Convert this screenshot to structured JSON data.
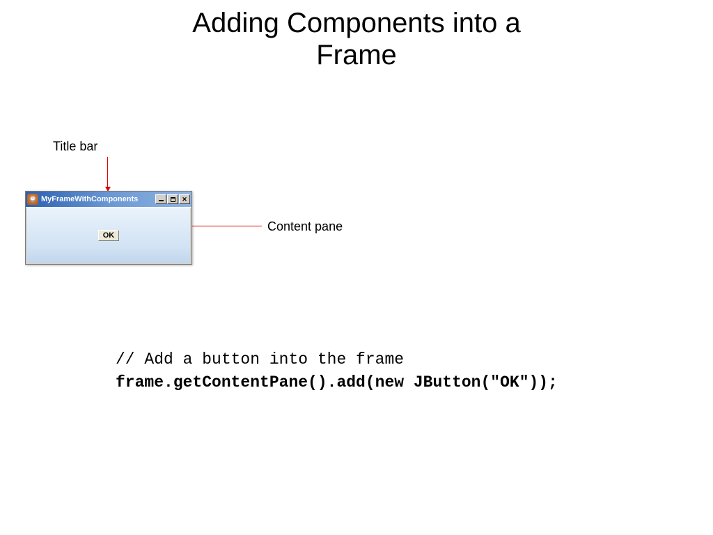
{
  "title_line1": "Adding Components into a",
  "title_line2": "Frame",
  "labels": {
    "titlebar": "Title bar",
    "contentpane": "Content pane"
  },
  "java_window": {
    "title": "MyFrameWithComponents",
    "button_label": "OK",
    "icon_glyph": "♨",
    "controls": {
      "minimize": "_",
      "maximize": "☐",
      "close": "✕"
    }
  },
  "code": {
    "comment": "// Add a button into the frame",
    "line": "frame.getContentPane().add(new JButton(\"OK\"));"
  }
}
